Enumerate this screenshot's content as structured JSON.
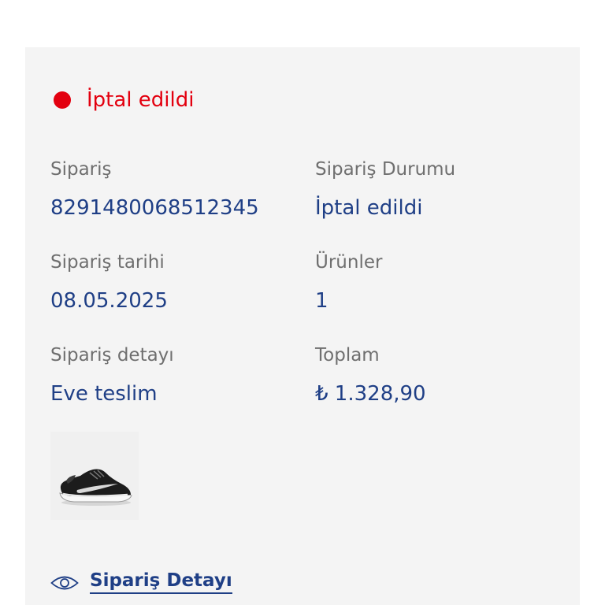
{
  "order": {
    "status": {
      "text": "İptal edildi",
      "color": "#e3000f"
    },
    "fields": {
      "order_number": {
        "label": "Sipariş",
        "value": "8291480068512345"
      },
      "order_status": {
        "label": "Sipariş Durumu",
        "value": "İptal edildi"
      },
      "order_date": {
        "label": "Sipariş tarihi",
        "value": "08.05.2025"
      },
      "products": {
        "label": "Ürünler",
        "value": "1"
      },
      "order_detail": {
        "label": "Sipariş detayı",
        "value": "Eve teslim"
      },
      "total": {
        "label": "Toplam",
        "value": "₺ 1.328,90"
      }
    },
    "product_image": "black-white-running-shoe",
    "detail_link": {
      "label": "Sipariş Detayı",
      "icon": "eye-icon"
    }
  },
  "colors": {
    "accent_blue": "#1f3f86",
    "status_red": "#e3000f",
    "card_background": "#f4f4f4"
  }
}
